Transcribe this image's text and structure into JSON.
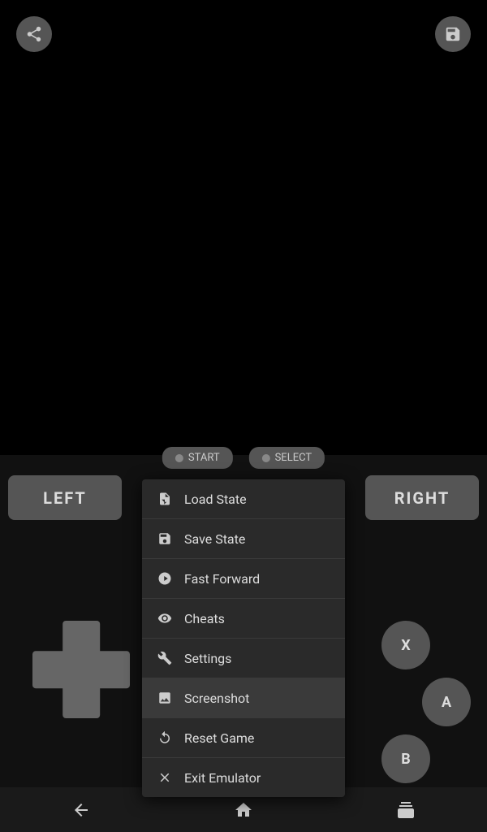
{
  "topButtons": {
    "share": "share",
    "save": "save"
  },
  "gameControls": {
    "left": "LEFT",
    "right": "RIGHT",
    "start": "START",
    "select": "SELECT",
    "btnX": "X",
    "btnA": "A",
    "btnB": "B"
  },
  "contextMenu": {
    "items": [
      {
        "id": "load-state",
        "label": "Load State",
        "icon": "load-icon"
      },
      {
        "id": "save-state",
        "label": "Save State",
        "icon": "save-icon"
      },
      {
        "id": "fast-forward",
        "label": "Fast Forward",
        "icon": "fast-forward-icon"
      },
      {
        "id": "cheats",
        "label": "Cheats",
        "icon": "eye-icon"
      },
      {
        "id": "settings",
        "label": "Settings",
        "icon": "wrench-icon"
      },
      {
        "id": "screenshot",
        "label": "Screenshot",
        "icon": "screenshot-icon",
        "highlighted": true
      },
      {
        "id": "reset-game",
        "label": "Reset Game",
        "icon": "reset-icon"
      },
      {
        "id": "exit-emulator",
        "label": "Exit Emulator",
        "icon": "x-icon"
      }
    ]
  },
  "navBar": {
    "back": "back",
    "home": "home",
    "recents": "recents"
  }
}
